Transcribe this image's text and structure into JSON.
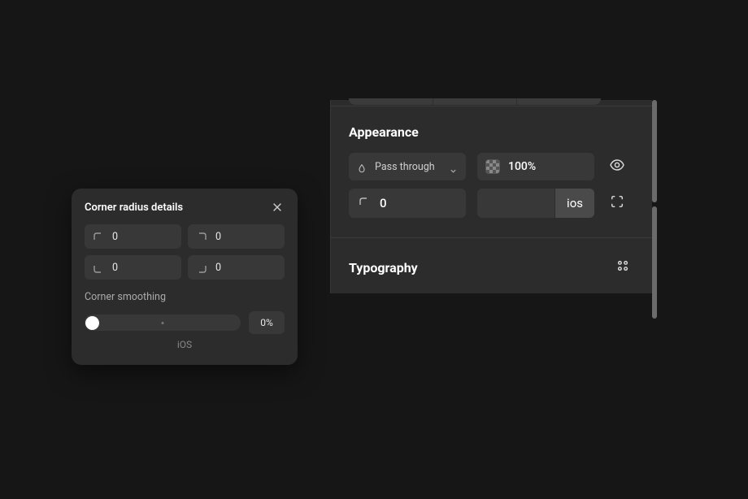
{
  "popover": {
    "title": "Corner radius details",
    "corners": {
      "topLeft": "0",
      "topRight": "0",
      "bottomLeft": "0",
      "bottomRight": "0"
    },
    "smoothing": {
      "label": "Corner smoothing",
      "value": "0%",
      "presetLabel": "iOS"
    }
  },
  "inspector": {
    "appearance": {
      "title": "Appearance",
      "blendMode": "Pass through",
      "opacity": "100%",
      "cornerRadius": "0",
      "smoothingPreset": "ios"
    },
    "typography": {
      "title": "Typography"
    }
  }
}
